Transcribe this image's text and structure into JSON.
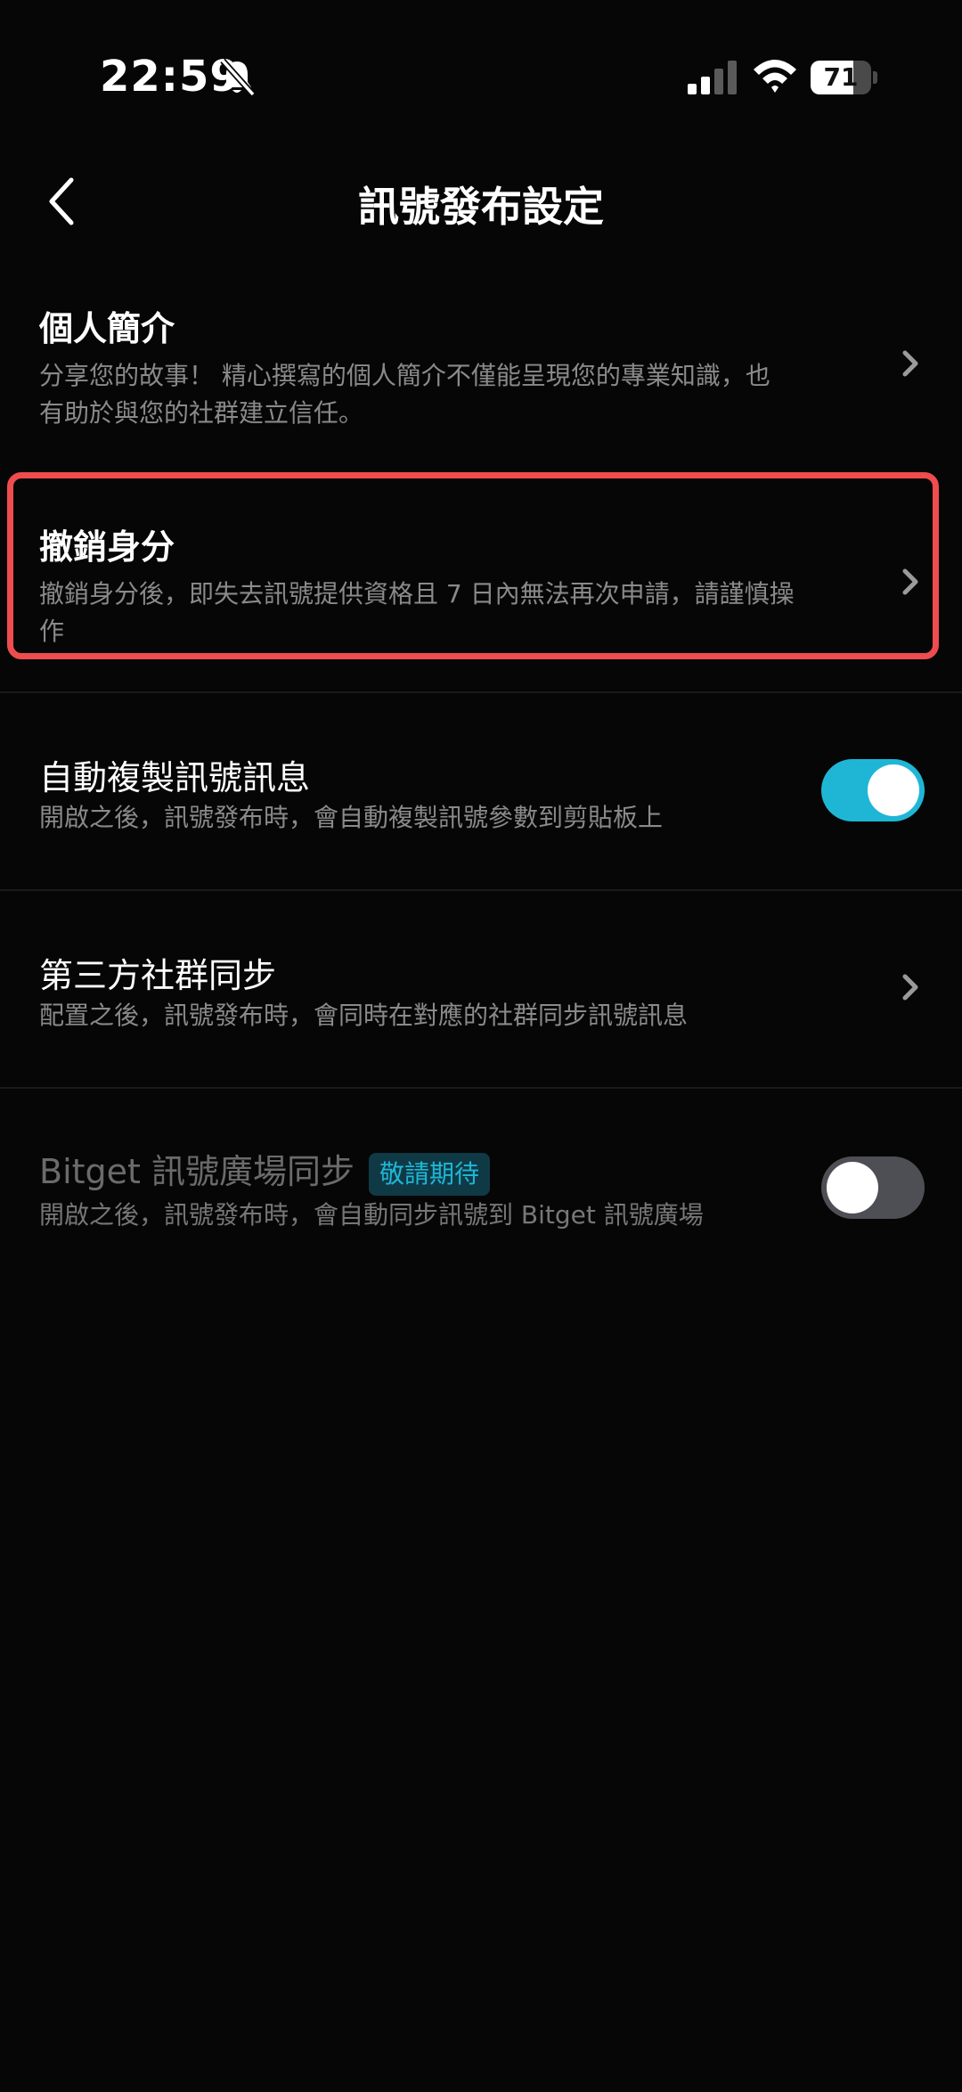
{
  "status_bar": {
    "time": "22:59",
    "battery": "71",
    "battery_level": 0.71
  },
  "header": {
    "title": "訊號發布設定"
  },
  "rows": [
    {
      "title": "個人簡介",
      "description_line1": "分享您的故事！ 精心撰寫的個人簡介不僅能呈現您的專業知識，也",
      "description_line2": "有助於與您的社群建立信任。"
    },
    {
      "title": "撤銷身分",
      "description_line1": "撤銷身分後，即失去訊號提供資格且 7 日內無法再次申請，請謹慎操",
      "description_line2": "作"
    },
    {
      "title": "自動複製訊號訊息",
      "description": "開啟之後，訊號發布時，會自動複製訊號參數到剪貼板上",
      "toggle_on": true
    },
    {
      "title": "第三方社群同步",
      "description": "配置之後，訊號發布時，會同時在對應的社群同步訊號訊息"
    },
    {
      "title": "Bitget 訊號廣場同步",
      "badge": "敬請期待",
      "description": "開啟之後，訊號發布時，會自動同步訊號到 Bitget 訊號廣場",
      "toggle_on": false
    }
  ],
  "colors": {
    "background": "#060606",
    "accent": "#1fb6d6",
    "highlight": "#ee4c4f",
    "muted_text": "#8a8a8a"
  }
}
